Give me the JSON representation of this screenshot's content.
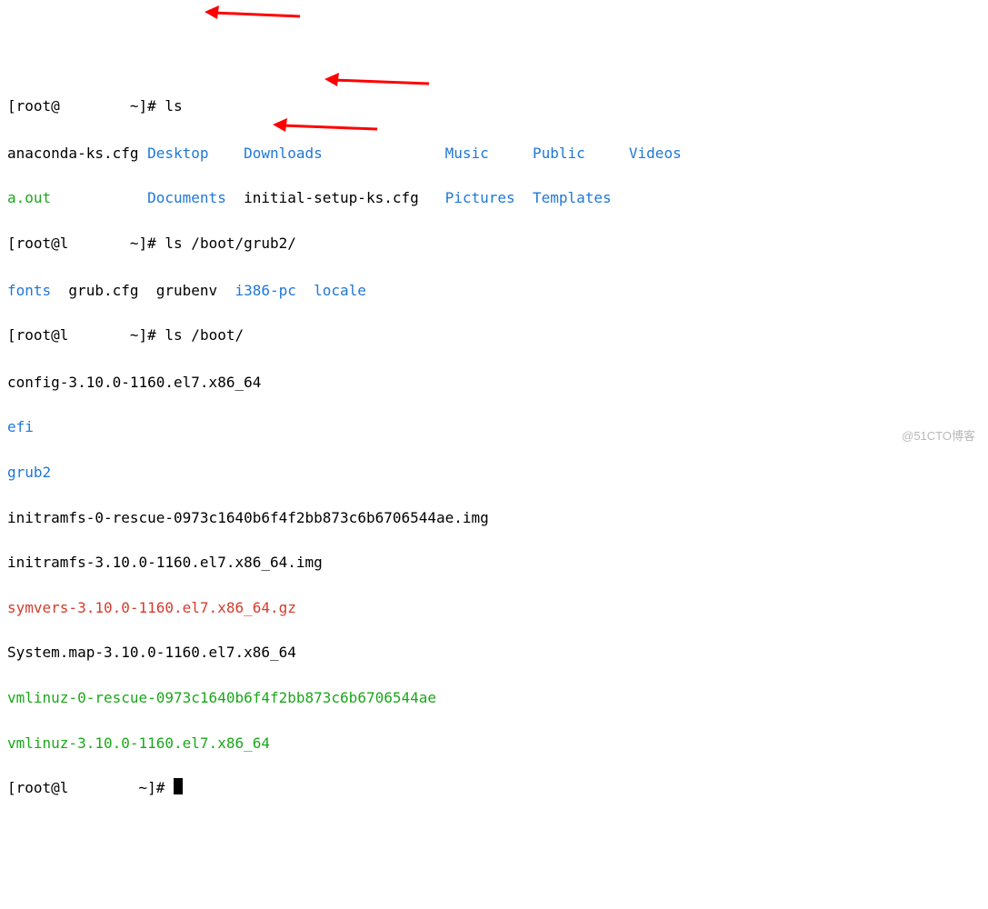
{
  "prompts": {
    "p1_open": "[root@",
    "p1_host_hidden": "        ",
    "p1_close": "~]# ",
    "cmd1": "ls",
    "cmd2": "ls /boot/grub2/",
    "cmd3": "ls /boot/",
    "p2_host_prefix": "l",
    "p2_host_hidden": "       ",
    "p3_host_prefix": "l",
    "p3_host_hidden": "       ",
    "p4_host_prefix": "l",
    "p4_host_hidden": "       ",
    "p4_close": " ~]# "
  },
  "ls1": {
    "r1": {
      "a": "anaconda-ks.cfg",
      "b": "Desktop",
      "c": "Downloads",
      "d": "Music",
      "e": "Public",
      "f": "Videos"
    },
    "r2": {
      "a": "a.out",
      "b": "Documents",
      "c": "initial-setup-ks.cfg",
      "d": "Pictures",
      "e": "Templates"
    }
  },
  "ls2": {
    "a": "fonts",
    "b": "grub.cfg",
    "c": "grubenv",
    "d": "i386-pc",
    "e": "locale"
  },
  "ls3": {
    "l1": "config-3.10.0-1160.el7.x86_64",
    "l2": "efi",
    "l3": "grub2",
    "l4": "initramfs-0-rescue-0973c1640b6f4f2bb873c6b6706544ae.img",
    "l5": "initramfs-3.10.0-1160.el7.x86_64.img",
    "l6": "symvers-3.10.0-1160.el7.x86_64.gz",
    "l7": "System.map-3.10.0-1160.el7.x86_64",
    "l8": "vmlinuz-0-rescue-0973c1640b6f4f2bb873c6b6706544ae",
    "l9": "vmlinuz-3.10.0-1160.el7.x86_64"
  },
  "watermark": "@51CTO博客"
}
